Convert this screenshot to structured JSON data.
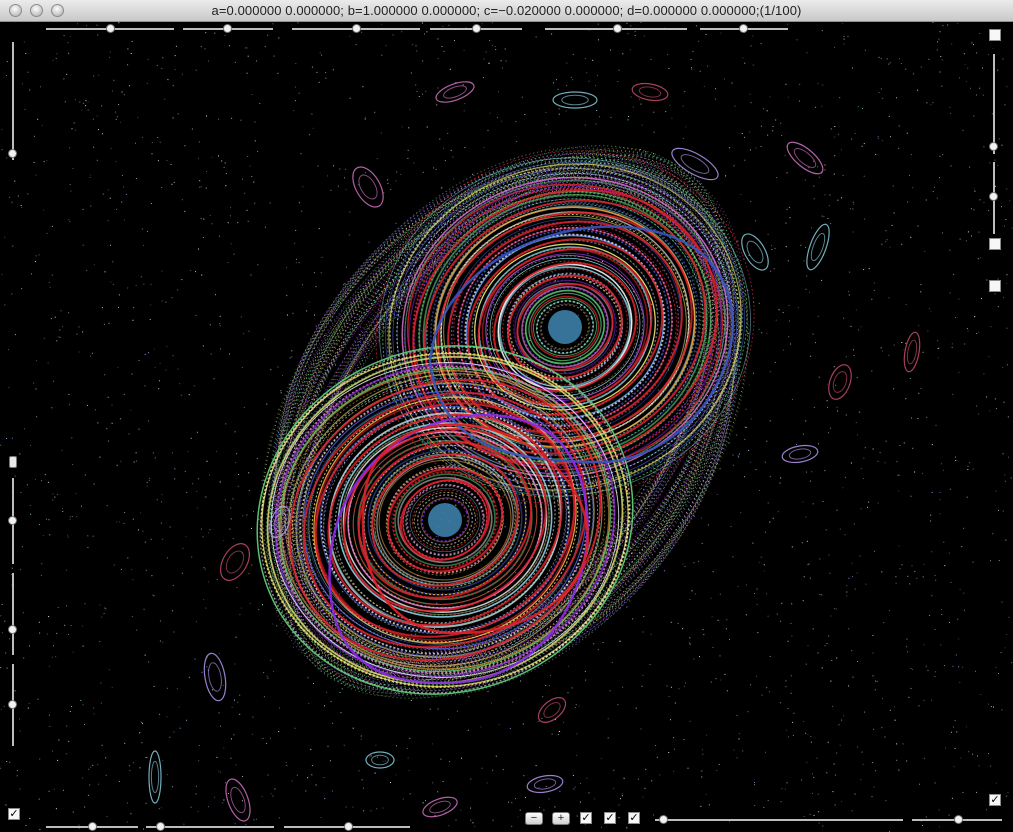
{
  "window": {
    "title": "a=0.000000 0.000000; b=1.000000 0.000000; c=−0.020000 0.000000; d=0.000000 0.000000;(1/100)"
  },
  "controls": {
    "minus_label": "−",
    "plus_label": "+",
    "checkbox_mark": "✓"
  },
  "colors": {
    "background": "#000000",
    "orbit_red": "#e0202a",
    "orbit_blue": "#3a55c0",
    "orbit_purple": "#8a2be2",
    "orbit_green": "#5fd07a",
    "orbit_yellow": "#e8e070",
    "orbit_pink": "#e07ad0",
    "orbit_cyan": "#8fd8e8",
    "core": "#3d7fa8"
  }
}
